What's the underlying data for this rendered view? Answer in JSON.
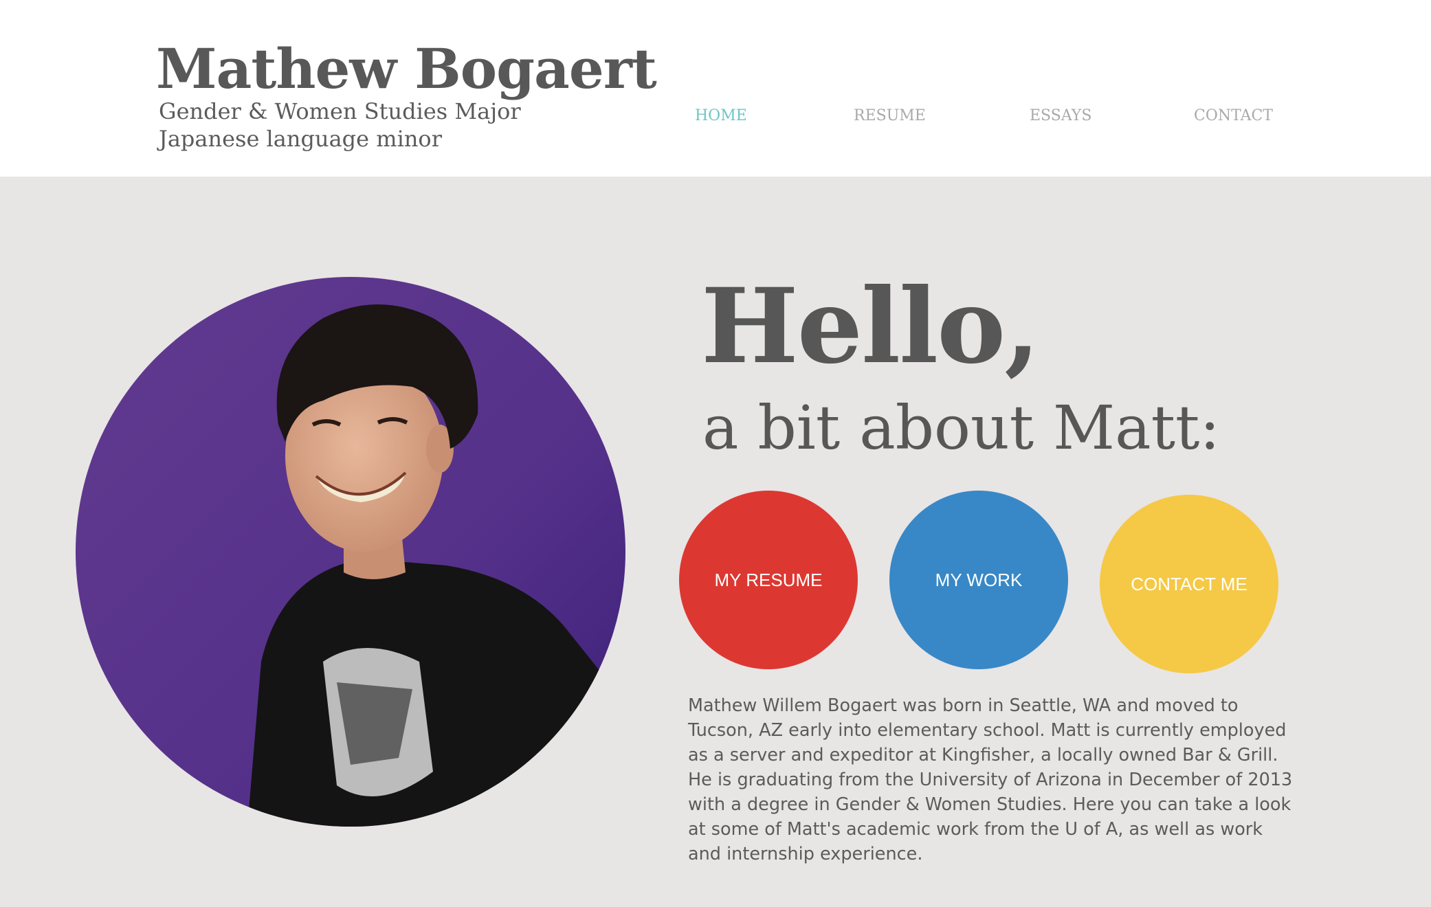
{
  "header": {
    "title": "Mathew Bogaert",
    "subtitle_line1": "Gender & Women Studies Major",
    "subtitle_line2": "Japanese language minor"
  },
  "nav": {
    "items": [
      {
        "label": "HOME",
        "active": true
      },
      {
        "label": "RESUME",
        "active": false
      },
      {
        "label": "ESSAYS",
        "active": false
      },
      {
        "label": "CONTACT",
        "active": false
      }
    ],
    "active_color": "#6cc6c6",
    "inactive_color": "#a9a9a9"
  },
  "hero": {
    "greeting": "Hello,",
    "tagline": "a bit about Matt:"
  },
  "buttons": [
    {
      "label": "MY RESUME",
      "color": "#dc3831"
    },
    {
      "label": "MY WORK",
      "color": "#3888c7"
    },
    {
      "label": "CONTACT ME",
      "color": "#f5c946"
    }
  ],
  "bio": "Mathew Willem Bogaert was born in Seattle, WA and moved to Tucson, AZ early into elementary school. Matt is currently employed as a server and expeditor at Kingfisher, a locally owned Bar & Grill. He is graduating from the University of Arizona in December of 2013 with a degree in Gender & Women Studies. Here you can take a look at some of Matt's academic work from the U of A, as well as work and internship experience.",
  "colors": {
    "page_background": "#e8e5e5",
    "header_background": "#ffffff",
    "text": "#575757",
    "portrait_background": "#5d3a8a"
  }
}
